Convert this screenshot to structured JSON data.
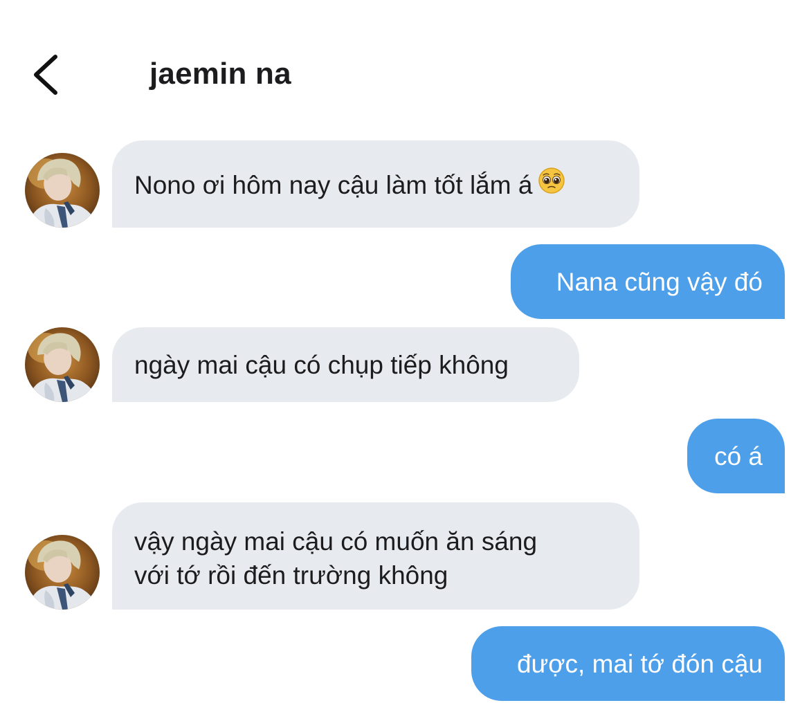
{
  "header": {
    "title": "jaemin na",
    "back_icon": "chevron-left-icon"
  },
  "contact": {
    "avatar_icon": "contact-avatar-photo"
  },
  "messages": [
    {
      "direction": "incoming",
      "text": "Nono ơi hôm nay cậu làm tốt lắm á",
      "emoji": "pleading-face-icon"
    },
    {
      "direction": "outgoing",
      "text": "Nana cũng vậy đó"
    },
    {
      "direction": "incoming",
      "text": "ngày mai cậu có chụp tiếp không"
    },
    {
      "direction": "outgoing",
      "text": "có á"
    },
    {
      "direction": "incoming",
      "lines": [
        "vậy ngày mai cậu có muốn ăn sáng",
        "với tớ rồi đến trường không"
      ]
    },
    {
      "direction": "outgoing",
      "text": "được, mai tớ đón cậu"
    }
  ],
  "colors": {
    "incoming_bubble": "#e7ebef",
    "outgoing_bubble": "#4d9fe9",
    "text_dark": "#1c1c1e",
    "text_light": "#ffffff"
  }
}
